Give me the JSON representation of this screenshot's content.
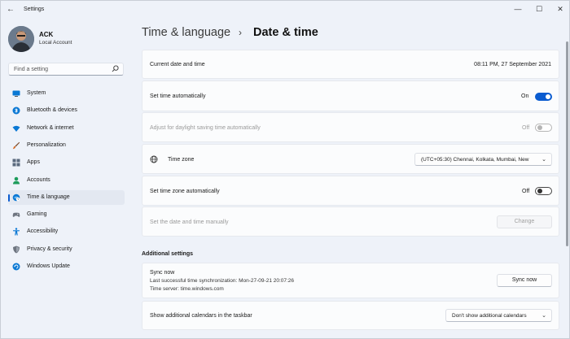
{
  "window": {
    "title": "Settings",
    "back_glyph": "←",
    "minimize_glyph": "—",
    "maximize_glyph": "☐",
    "close_glyph": "✕"
  },
  "user": {
    "name": "ACK",
    "account_type": "Local Account"
  },
  "search": {
    "placeholder": "Find a setting"
  },
  "sidebar": {
    "items": [
      {
        "label": "System",
        "icon": "monitor-icon",
        "color": "#0a78d4",
        "active": false
      },
      {
        "label": "Bluetooth & devices",
        "icon": "bluetooth-icon",
        "color": "#0a78d4",
        "active": false
      },
      {
        "label": "Network & internet",
        "icon": "wifi-icon",
        "color": "#0a78d4",
        "active": false
      },
      {
        "label": "Personalization",
        "icon": "paintbrush-icon",
        "color": "#d36c28",
        "active": false
      },
      {
        "label": "Apps",
        "icon": "apps-icon",
        "color": "#5b6a7e",
        "active": false
      },
      {
        "label": "Accounts",
        "icon": "person-icon",
        "color": "#1e9c5c",
        "active": false
      },
      {
        "label": "Time & language",
        "icon": "globe-clock-icon",
        "color": "#0a78d4",
        "active": true
      },
      {
        "label": "Gaming",
        "icon": "gamepad-icon",
        "color": "#6e7580",
        "active": false
      },
      {
        "label": "Accessibility",
        "icon": "accessibility-icon",
        "color": "#0a78d4",
        "active": false
      },
      {
        "label": "Privacy & security",
        "icon": "shield-icon",
        "color": "#6e7580",
        "active": false
      },
      {
        "label": "Windows Update",
        "icon": "update-icon",
        "color": "#0a78d4",
        "active": false
      }
    ]
  },
  "breadcrumb": {
    "parent": "Time & language",
    "separator": "›",
    "current": "Date & time"
  },
  "settings": {
    "current_date_time": {
      "label": "Current date and time",
      "value": "08:11 PM, 27 September 2021"
    },
    "set_time_auto": {
      "label": "Set time automatically",
      "state": "On"
    },
    "daylight_saving": {
      "label": "Adjust for daylight saving time automatically",
      "state": "Off"
    },
    "time_zone": {
      "label": "Time zone",
      "value": "(UTC+05:30) Chennai, Kolkata, Mumbai, New"
    },
    "time_zone_auto": {
      "label": "Set time zone automatically",
      "state": "Off"
    },
    "manual_date_time": {
      "label": "Set the date and time manually",
      "button": "Change"
    }
  },
  "additional": {
    "title": "Additional settings",
    "sync": {
      "title": "Sync now",
      "last_sync": "Last successful time synchronization: Mon-27-09-21 20:07:26",
      "server": "Time server: time.windows.com",
      "button": "Sync now"
    },
    "calendars": {
      "label": "Show additional calendars in the taskbar",
      "value": "Don't show additional calendars"
    }
  },
  "colors": {
    "accent": "#0b5cd0",
    "background": "#eef2f9",
    "card": "#fbfcfd"
  }
}
